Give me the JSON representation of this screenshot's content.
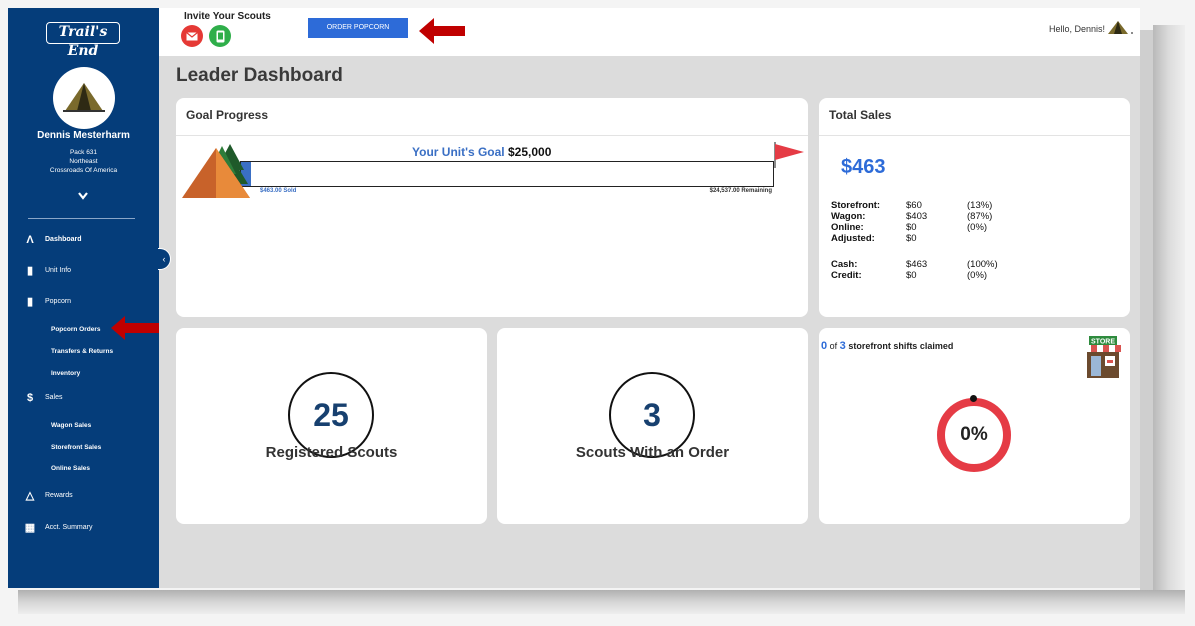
{
  "sidebar": {
    "logo_text": "Trail's End",
    "user_name": "Dennis Mesterharm",
    "unit": "Pack 631",
    "region": "Northeast",
    "council": "Crossroads Of America",
    "nav": {
      "dashboard": "Dashboard",
      "unit_info": "Unit Info",
      "popcorn": "Popcorn",
      "popcorn_orders": "Popcorn Orders",
      "transfers_returns": "Transfers & Returns",
      "inventory": "Inventory",
      "sales": "Sales",
      "wagon_sales": "Wagon Sales",
      "storefront_sales": "Storefront Sales",
      "online_sales": "Online Sales",
      "rewards": "Rewards",
      "acct_summary": "Acct. Summary"
    }
  },
  "topbar": {
    "invite_label": "Invite Your Scouts",
    "order_button": "ORDER POPCORN",
    "greeting": "Hello, Dennis!"
  },
  "page_title": "Leader Dashboard",
  "goal_progress": {
    "header": "Goal Progress",
    "goal_label": "Your Unit's Goal",
    "goal_amount": "$25,000",
    "sold": "$463.00 Sold",
    "remaining": "$24,537.00 Remaining",
    "progress_fraction": 0.0185
  },
  "total_sales": {
    "header": "Total Sales",
    "total": "$463",
    "rows": [
      {
        "label": "Storefront:",
        "value": "$60",
        "pct": "(13%)"
      },
      {
        "label": "Wagon:",
        "value": "$403",
        "pct": "(87%)"
      },
      {
        "label": "Online:",
        "value": "$0",
        "pct": "(0%)"
      },
      {
        "label": "Adjusted:",
        "value": "$0",
        "pct": ""
      },
      {
        "label": "Cash:",
        "value": "$463",
        "pct": "(100%)"
      },
      {
        "label": "Credit:",
        "value": "$0",
        "pct": "(0%)"
      }
    ]
  },
  "registered_scouts": {
    "value": "25",
    "label": "Registered Scouts"
  },
  "scouts_with_order": {
    "value": "3",
    "label": "Scouts With an Order"
  },
  "storefront_shifts": {
    "claimed": "0",
    "of_word": "of",
    "total": "3",
    "suffix": "storefront shifts claimed",
    "percent": "0%",
    "store_sign": "STORE"
  },
  "colors": {
    "sidebar": "#053d7a",
    "accent_blue": "#2d6bd8",
    "donut_red": "#e53b45",
    "annotation_arrow": "#c00000"
  }
}
